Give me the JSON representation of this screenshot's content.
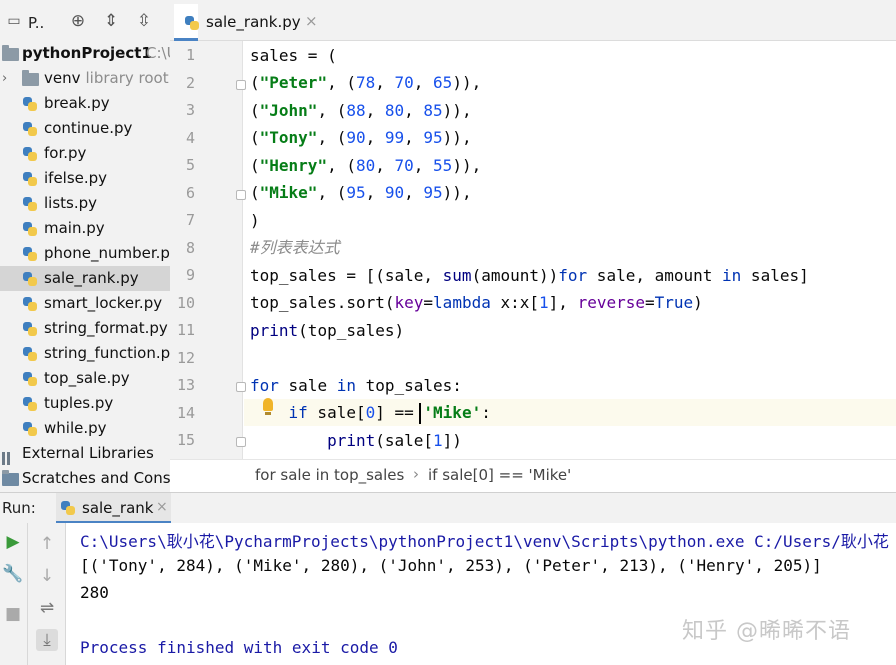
{
  "project": {
    "title": "P..",
    "root_name": "pythonProject1",
    "root_path": "C:\\U",
    "venv_name": "venv",
    "venv_hint": "library root",
    "files": [
      "break.py",
      "continue.py",
      "for.py",
      "ifelse.py",
      "lists.py",
      "main.py",
      "phone_number.py",
      "sale_rank.py",
      "smart_locker.py",
      "string_format.py",
      "string_function.py",
      "top_sale.py",
      "tuples.py",
      "while.py"
    ],
    "selected_file": "sale_rank.py",
    "external_libraries": "External Libraries",
    "scratches": "Scratches and Consoles"
  },
  "editor": {
    "tab_label": "sale_rank.py",
    "tab_close": "×",
    "line_numbers": [
      "1",
      "2",
      "3",
      "4",
      "5",
      "6",
      "7",
      "8",
      "9",
      "10",
      "11",
      "12",
      "13",
      "14",
      "15"
    ]
  },
  "breadcrumb": {
    "item1": "for sale in top_sales",
    "separator": "›",
    "item2": "if sale[0] == 'Mike'"
  },
  "run": {
    "label": "Run:",
    "tab_label": "sale_rank",
    "tab_close": "×",
    "console": {
      "command": "C:\\Users\\耿小花\\PycharmProjects\\pythonProject1\\venv\\Scripts\\python.exe C:/Users/耿小花",
      "output1": "[('Tony', 284), ('Mike', 280), ('John', 253), ('Peter', 213), ('Henry', 205)]",
      "output2": "280",
      "finished": "Process finished with exit code 0"
    }
  },
  "watermark": "知乎 @晞晞不语",
  "colors": {
    "keyword": "#0033b3",
    "string": "#067d17",
    "number": "#1750eb",
    "comment": "#8c8c8c",
    "kwarg": "#660099",
    "accent": "#4a83c4"
  }
}
